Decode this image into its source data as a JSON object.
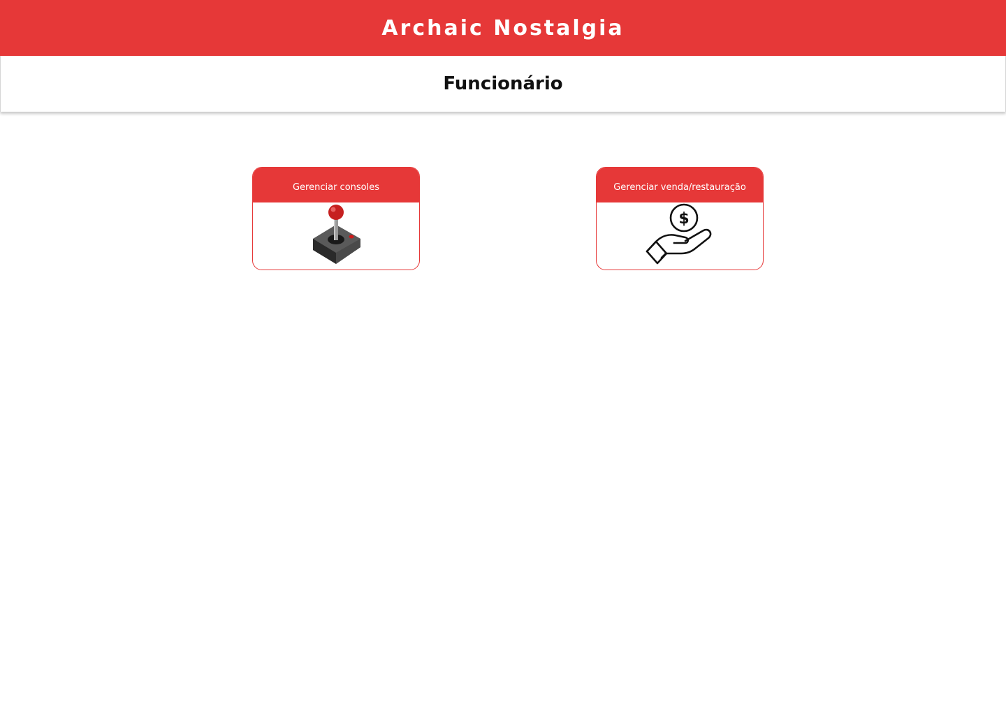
{
  "header": {
    "brand": "Archaic Nostalgia",
    "background_color": "#e63838"
  },
  "subheader": {
    "title": "Funcionário"
  },
  "cards": [
    {
      "label": "Gerenciar consoles",
      "icon": "joystick-icon"
    },
    {
      "label": "Gerenciar venda/restauração",
      "icon": "money-hand-icon"
    }
  ],
  "accent_color": "#e63838"
}
